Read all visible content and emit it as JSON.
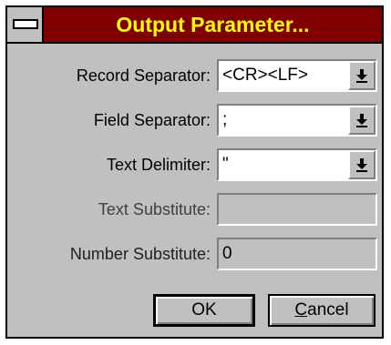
{
  "dialog": {
    "title": "Output Parameter...",
    "record_separator": {
      "label": "Record Separator:",
      "value": "<CR><LF>"
    },
    "field_separator": {
      "label": "Field Separator:",
      "value": ";"
    },
    "text_delimiter": {
      "label": "Text Delimiter:",
      "value": "\""
    },
    "text_substitute": {
      "label": "Text Substitute:",
      "value": ""
    },
    "number_substitute": {
      "label": "Number Substitute:",
      "value": "0"
    },
    "ok_label": "OK",
    "cancel_first": "C",
    "cancel_rest": "ancel"
  },
  "icons": {
    "system_menu": "system-menu-icon",
    "dropdown": "dropdown-arrow-icon"
  },
  "colors": {
    "title_bar": "#800000",
    "title_text": "#ffff00",
    "face": "#c0c0c0"
  }
}
